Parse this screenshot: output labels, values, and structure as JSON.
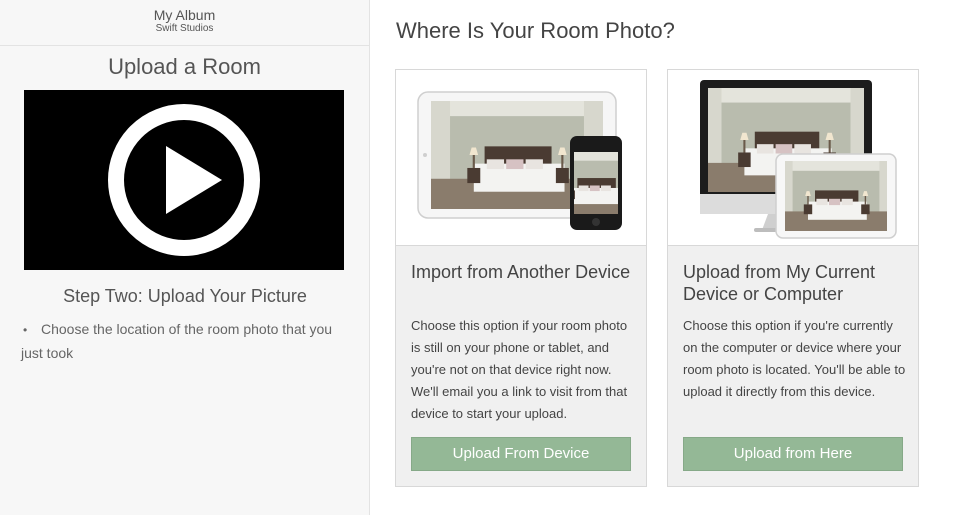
{
  "sidebar": {
    "album_title": "My Album",
    "album_subtitle": "Swift Studios",
    "heading": "Upload a Room",
    "video_icon": "play-icon",
    "step_title": "Step Two: Upload Your Picture",
    "steps": [
      {
        "bullet": "•",
        "text": "Choose the location of the room photo that you just took"
      }
    ]
  },
  "main": {
    "title": "Where Is Your Room Photo?",
    "cards": [
      {
        "title": "Import from Another Device",
        "description": "Choose this option if your room photo is still on your phone or tablet, and you're not on that device right now. We'll email you a link to visit from that device to start your upload.",
        "button_label": "Upload From Device",
        "image": "tablet-and-phone-bedroom-photo"
      },
      {
        "title": "Upload from My Current Device or Computer",
        "description": "Choose this option if you're currently on the computer or device where your room photo is located. You'll be able to upload it directly from this device.",
        "button_label": "Upload from Here",
        "image": "computer-and-tablet-bedroom-photo"
      }
    ]
  },
  "colors": {
    "button": "#94b896",
    "sidebar_bg": "#f7f7f7",
    "card_bg": "#f0f0f0",
    "video_bg": "#000000"
  }
}
